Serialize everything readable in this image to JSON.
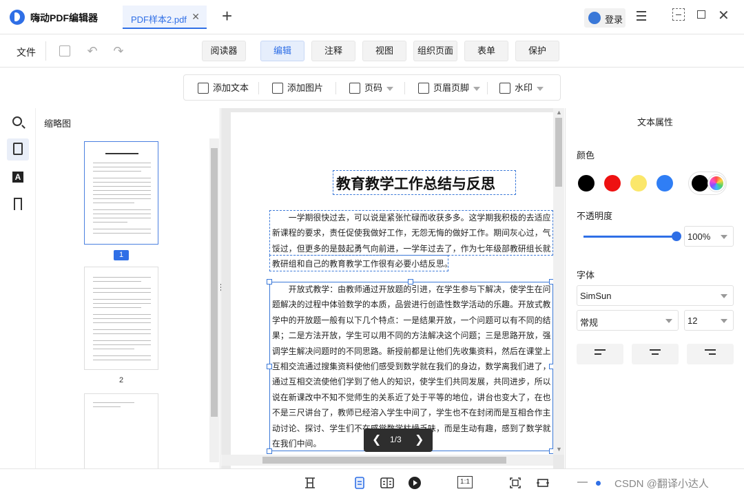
{
  "app": {
    "title": "嗨动PDF编辑器"
  },
  "tabs": [
    {
      "label": "PDF样本2.pdf"
    }
  ],
  "header": {
    "login_label": "登录"
  },
  "menubar": {
    "file_label": "文件",
    "modes": [
      "阅读器",
      "编辑",
      "注释",
      "视图",
      "组织页面",
      "表单",
      "保护"
    ],
    "active_mode": "编辑"
  },
  "edit_toolbar": {
    "add_text": "添加文本",
    "add_image": "添加图片",
    "page_number": "页码",
    "header_footer": "页眉页脚",
    "watermark": "水印"
  },
  "thumbnails": {
    "title": "缩略图",
    "page_labels": [
      "1",
      "2"
    ],
    "selected_page": "1"
  },
  "document": {
    "title": "教育教学工作总结与反思",
    "para1_lines": [
      "　　一学期很快过去，可以说是紧张忙碌而收获多多。这学期我积极的去适应",
      "新课程的要求，责任促使我做好工作，无怨无悔的做好工作。期间灰心过，气",
      "馁过，但更多的是鼓起勇气向前进，一学年过去了，作为七年级部教研组长就",
      "教研组和自己的教育教学工作很有必要小结反思。"
    ],
    "para2_lines": [
      "　　开放式教学：由教师通过开放题的引进，在学生参与下解决，使学生在问",
      "题解决的过程中体验数学的本质，品尝进行创造性数学活动的乐趣。开放式教",
      "学中的开放题一般有以下几个特点：一是结果开放，一个问题可以有不同的结",
      "果；二是方法开放，学生可以用不同的方法解决这个问题；三是思路开放，强",
      "调学生解决问题时的不同思路。新授前都是让他们先收集资料，然后在课堂上",
      "互相交流通过搜集资料使他们感受到数学就在我们的身边，数学离我们进了，",
      "通过互相交流使他们学到了他人的知识，使学生们共同发展，共同进步，所以",
      "说在新课改中不知不觉师生的关系近了处于平等的地位，讲台也变大了，在也",
      "不是三尺讲台了，教师已经溶入学生中间了，学生也不在封闭而是互相合作主",
      "动讨论、探讨、学生们不在感觉数学枯燥乏味，而是生动有趣，感到了数学就",
      "在我们中间。"
    ],
    "pager_text": "1/3"
  },
  "properties": {
    "title": "文本属性",
    "color_label": "颜色",
    "colors": [
      "#000000",
      "#ee1111",
      "#fbe76a",
      "#2f7ef5"
    ],
    "current_color": "#000000",
    "opacity_label": "不透明度",
    "opacity_value": "100%",
    "opacity_fraction": 1.0,
    "font_label": "字体",
    "font_family": "SimSun",
    "font_style": "常规",
    "font_size": "12",
    "align_options": [
      "align-left",
      "align-center",
      "align-right"
    ]
  },
  "status": {
    "ratio_label": "1:1",
    "watermark_text": "CSDN @翻译小达人"
  }
}
